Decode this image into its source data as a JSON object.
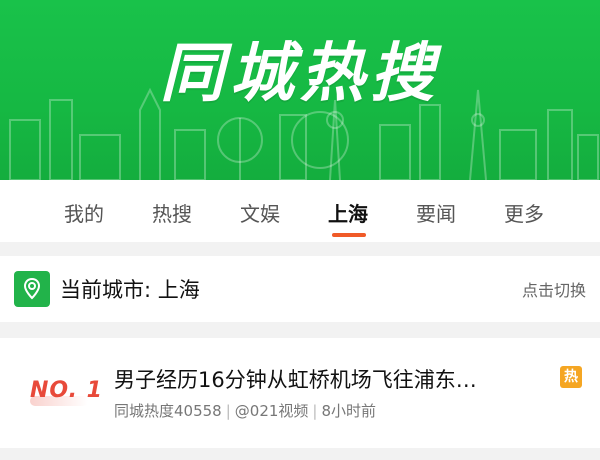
{
  "banner": {
    "title": "同城热搜",
    "background_color": "#16b843"
  },
  "tabs": [
    {
      "label": "我的",
      "active": false
    },
    {
      "label": "热搜",
      "active": false
    },
    {
      "label": "文娱",
      "active": false
    },
    {
      "label": "上海",
      "active": true
    },
    {
      "label": "要闻",
      "active": false
    },
    {
      "label": "更多",
      "active": false
    }
  ],
  "accent_color": "#f05a28",
  "city": {
    "label": "当前城市: 上海",
    "switch_label": "点击切换",
    "icon": "location-pin-icon"
  },
  "news": [
    {
      "rank": "NO. 1",
      "title": "男子经历16分钟从虹桥机场飞往浦东…",
      "badge": "热",
      "heat": "同城热度40558",
      "source": "@021视频",
      "time": "8小时前"
    }
  ]
}
